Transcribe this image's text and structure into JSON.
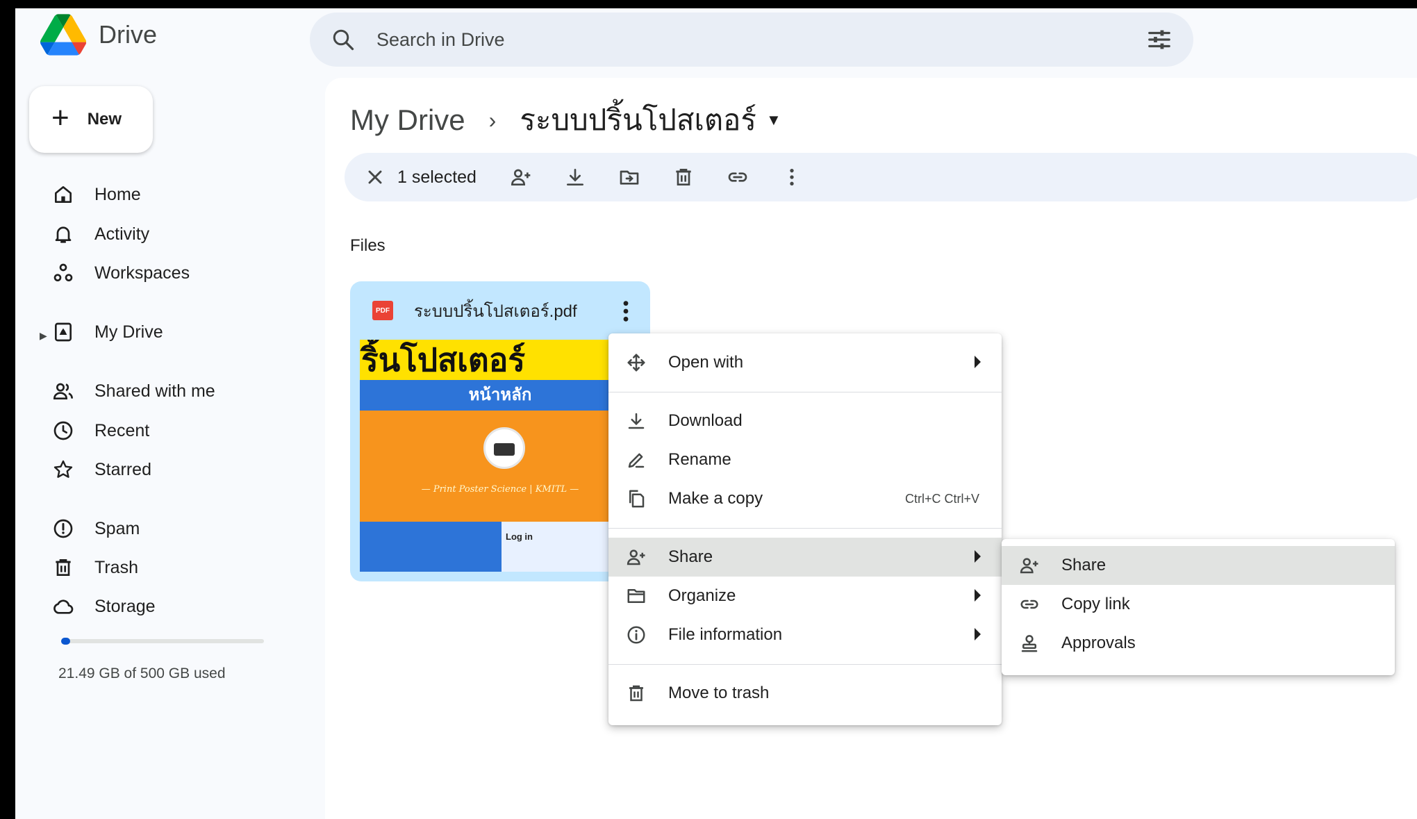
{
  "app": {
    "name": "Drive"
  },
  "search": {
    "placeholder": "Search in Drive"
  },
  "sidebar": {
    "new_label": "New",
    "items": [
      {
        "label": "Home",
        "icon": "home-icon"
      },
      {
        "label": "Activity",
        "icon": "bell-icon"
      },
      {
        "label": "Workspaces",
        "icon": "workspaces-icon"
      },
      {
        "label": "My Drive",
        "icon": "my-drive-icon"
      },
      {
        "label": "Shared with me",
        "icon": "people-icon"
      },
      {
        "label": "Recent",
        "icon": "clock-icon"
      },
      {
        "label": "Starred",
        "icon": "star-icon"
      },
      {
        "label": "Spam",
        "icon": "spam-icon"
      },
      {
        "label": "Trash",
        "icon": "trash-icon"
      },
      {
        "label": "Storage",
        "icon": "cloud-icon"
      }
    ],
    "storage_text": "21.49 GB of 500 GB used",
    "storage_used_fraction": 0.043
  },
  "breadcrumb": {
    "root": "My Drive",
    "current": "ระบบปริ้นโปสเตอร์"
  },
  "toolbar": {
    "selected_label": "1 selected",
    "actions": [
      "close-icon",
      "share-icon",
      "download-icon",
      "move-icon",
      "trash-icon",
      "link-icon",
      "more-icon"
    ]
  },
  "files": {
    "section_label": "Files",
    "items": [
      {
        "name": "ระบบปริ้นโปสเตอร์.pdf",
        "type_badge": "PDF",
        "thumb": {
          "title": "ริ้นโปสเตอร์",
          "subtitle": "หน้าหลัก",
          "script": "— Print Poster Science | KMITL —",
          "login": "Log in"
        }
      }
    ]
  },
  "context_menu": {
    "items": [
      {
        "label": "Open with",
        "icon": "open-with-icon",
        "submenu": true
      },
      {
        "label": "Download",
        "icon": "download-icon"
      },
      {
        "label": "Rename",
        "icon": "rename-icon"
      },
      {
        "label": "Make a copy",
        "icon": "copy-icon",
        "shortcut": "Ctrl+C Ctrl+V"
      },
      {
        "label": "Share",
        "icon": "share-icon",
        "submenu": true,
        "highlighted": true
      },
      {
        "label": "Organize",
        "icon": "folder-icon",
        "submenu": true
      },
      {
        "label": "File information",
        "icon": "info-icon",
        "submenu": true
      },
      {
        "label": "Move to trash",
        "icon": "trash-icon"
      }
    ]
  },
  "share_submenu": {
    "items": [
      {
        "label": "Share",
        "icon": "share-icon",
        "highlighted": true
      },
      {
        "label": "Copy link",
        "icon": "link-icon"
      },
      {
        "label": "Approvals",
        "icon": "approvals-icon"
      }
    ]
  },
  "colors": {
    "accent": "#0b57d0",
    "page_bg": "#f8fafd",
    "search_bg": "#e9eef6",
    "toolbar_bg": "#edf2fa",
    "selected_card": "#c2e7ff",
    "menu_highlight": "#e1e3e1",
    "pdf_red": "#ea4335"
  }
}
